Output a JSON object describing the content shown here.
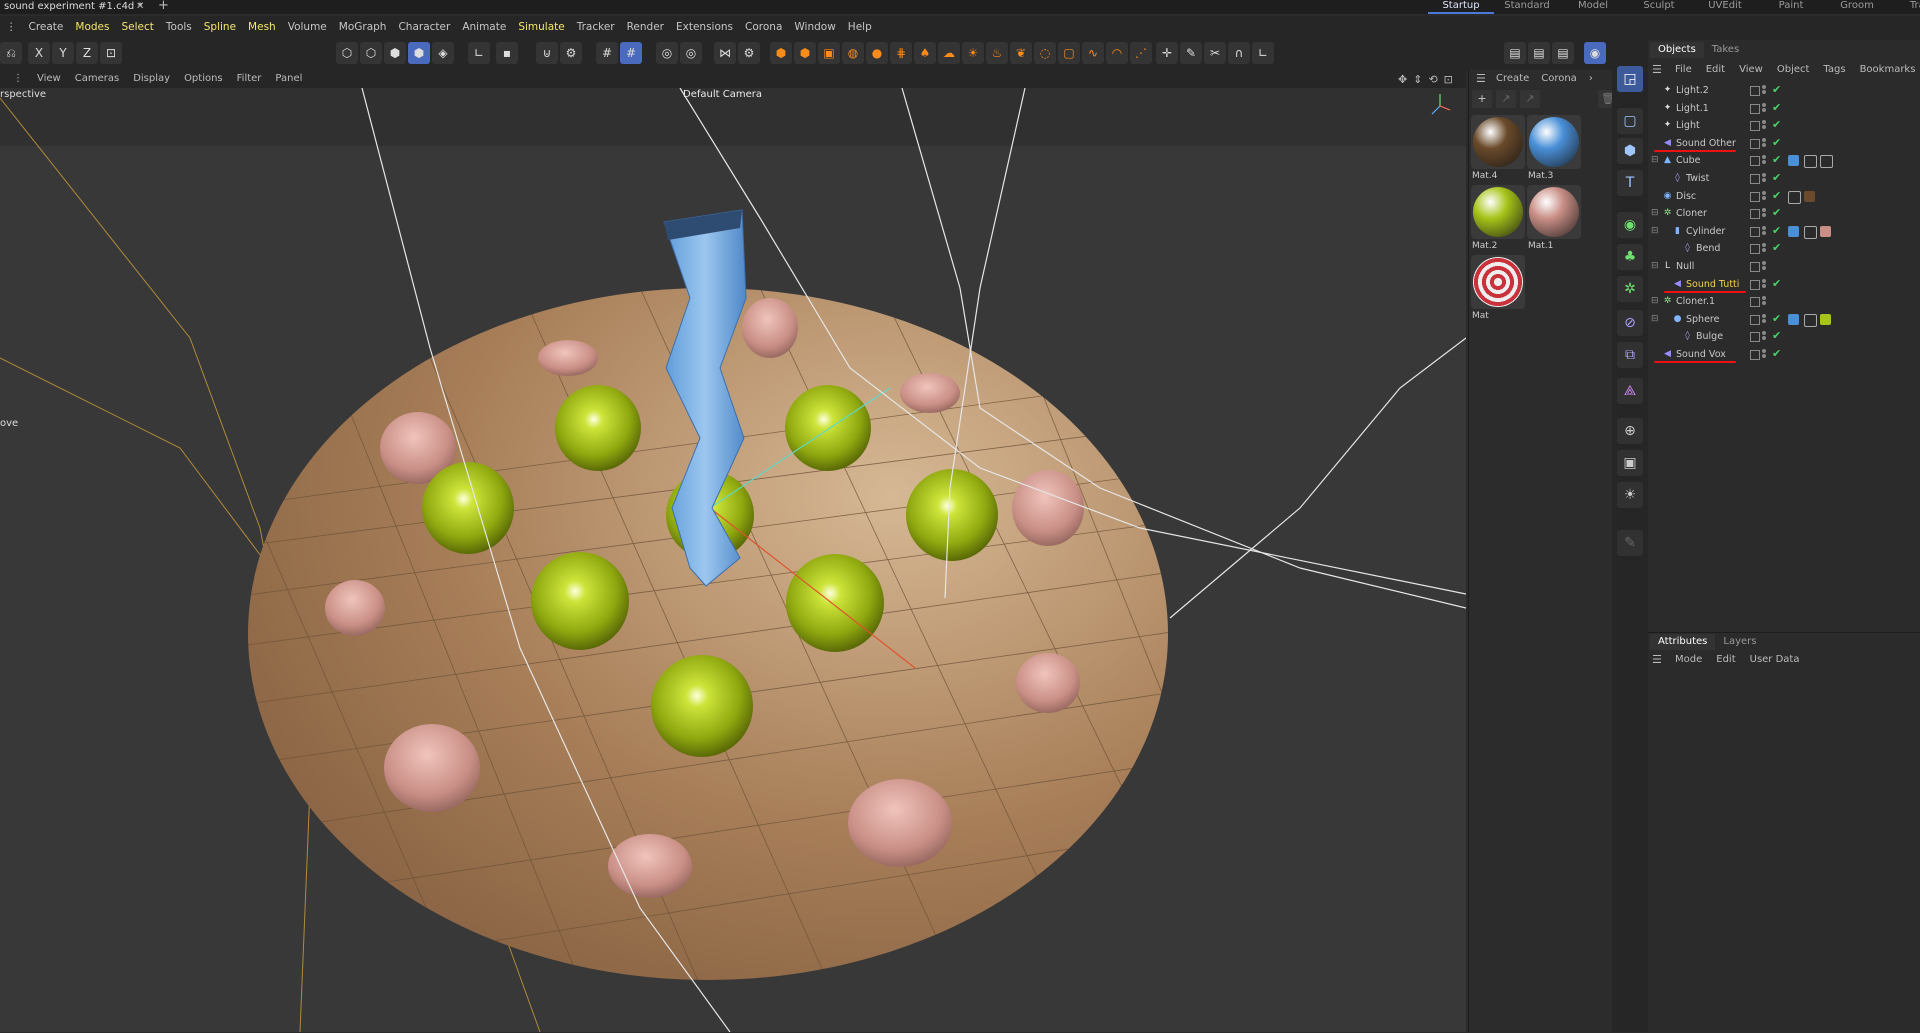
{
  "document": {
    "title": "sound experiment #1.c4d *",
    "close": "✕",
    "add": "+"
  },
  "layouts": [
    "Startup",
    "Standard",
    "Model",
    "Sculpt",
    "UVEdit",
    "Paint",
    "Groom",
    "Track"
  ],
  "menu": [
    "Create",
    "Modes",
    "Select",
    "Tools",
    "Spline",
    "Mesh",
    "Volume",
    "MoGraph",
    "Character",
    "Animate",
    "Simulate",
    "Tracker",
    "Render",
    "Extensions",
    "Corona",
    "Window",
    "Help"
  ],
  "menu_highlighted": [
    "Modes",
    "Select",
    "Spline",
    "Mesh",
    "Simulate"
  ],
  "axis_buttons": [
    "X",
    "Y",
    "Z"
  ],
  "viewport": {
    "menu": [
      "View",
      "Cameras",
      "Display",
      "Options",
      "Filter",
      "Panel"
    ],
    "view_name": "rspective",
    "camera": "Default Camera",
    "tool_label": "ove"
  },
  "materials": {
    "menu": [
      "Create",
      "Corona"
    ],
    "items": [
      {
        "name": "Mat.4",
        "color": "#6a4a2a"
      },
      {
        "name": "Mat.3",
        "color": "#4a90d8"
      },
      {
        "name": "Mat.2",
        "color": "#a6c419"
      },
      {
        "name": "Mat.1",
        "color": "#c98f86"
      },
      {
        "name": "Mat",
        "color": "#c9323a"
      }
    ]
  },
  "objects": {
    "tabs": [
      "Objects",
      "Takes"
    ],
    "menu": [
      "File",
      "Edit",
      "View",
      "Object",
      "Tags",
      "Bookmarks"
    ],
    "rows": [
      {
        "name": "Light.2",
        "indent": 0,
        "icon": "light-icon"
      },
      {
        "name": "Light.1",
        "indent": 0,
        "icon": "light-icon"
      },
      {
        "name": "Light",
        "indent": 0,
        "icon": "light-icon"
      },
      {
        "name": "Sound Other",
        "indent": 0,
        "icon": "sound-icon",
        "highlight": true
      },
      {
        "name": "Cube",
        "indent": 0,
        "icon": "cube-icon"
      },
      {
        "name": "Twist",
        "indent": 1,
        "icon": "deformer-icon"
      },
      {
        "name": "Disc",
        "indent": 0,
        "icon": "disc-icon"
      },
      {
        "name": "Cloner",
        "indent": 0,
        "icon": "cloner-icon"
      },
      {
        "name": "Cylinder",
        "indent": 1,
        "icon": "cylinder-icon"
      },
      {
        "name": "Bend",
        "indent": 2,
        "icon": "deformer-icon"
      },
      {
        "name": "Null",
        "indent": 0,
        "icon": "null-icon"
      },
      {
        "name": "Sound Tutti",
        "indent": 1,
        "icon": "sound-icon",
        "highlight": true
      },
      {
        "name": "Cloner.1",
        "indent": 0,
        "icon": "cloner-icon"
      },
      {
        "name": "Sphere",
        "indent": 1,
        "icon": "sphere-icon"
      },
      {
        "name": "Bulge",
        "indent": 2,
        "icon": "deformer-icon"
      },
      {
        "name": "Sound Vox",
        "indent": 0,
        "icon": "sound-icon",
        "highlight": true
      }
    ]
  },
  "attributes": {
    "tabs": [
      "Attributes",
      "Layers"
    ],
    "menu": [
      "Mode",
      "Edit",
      "User Data"
    ]
  }
}
